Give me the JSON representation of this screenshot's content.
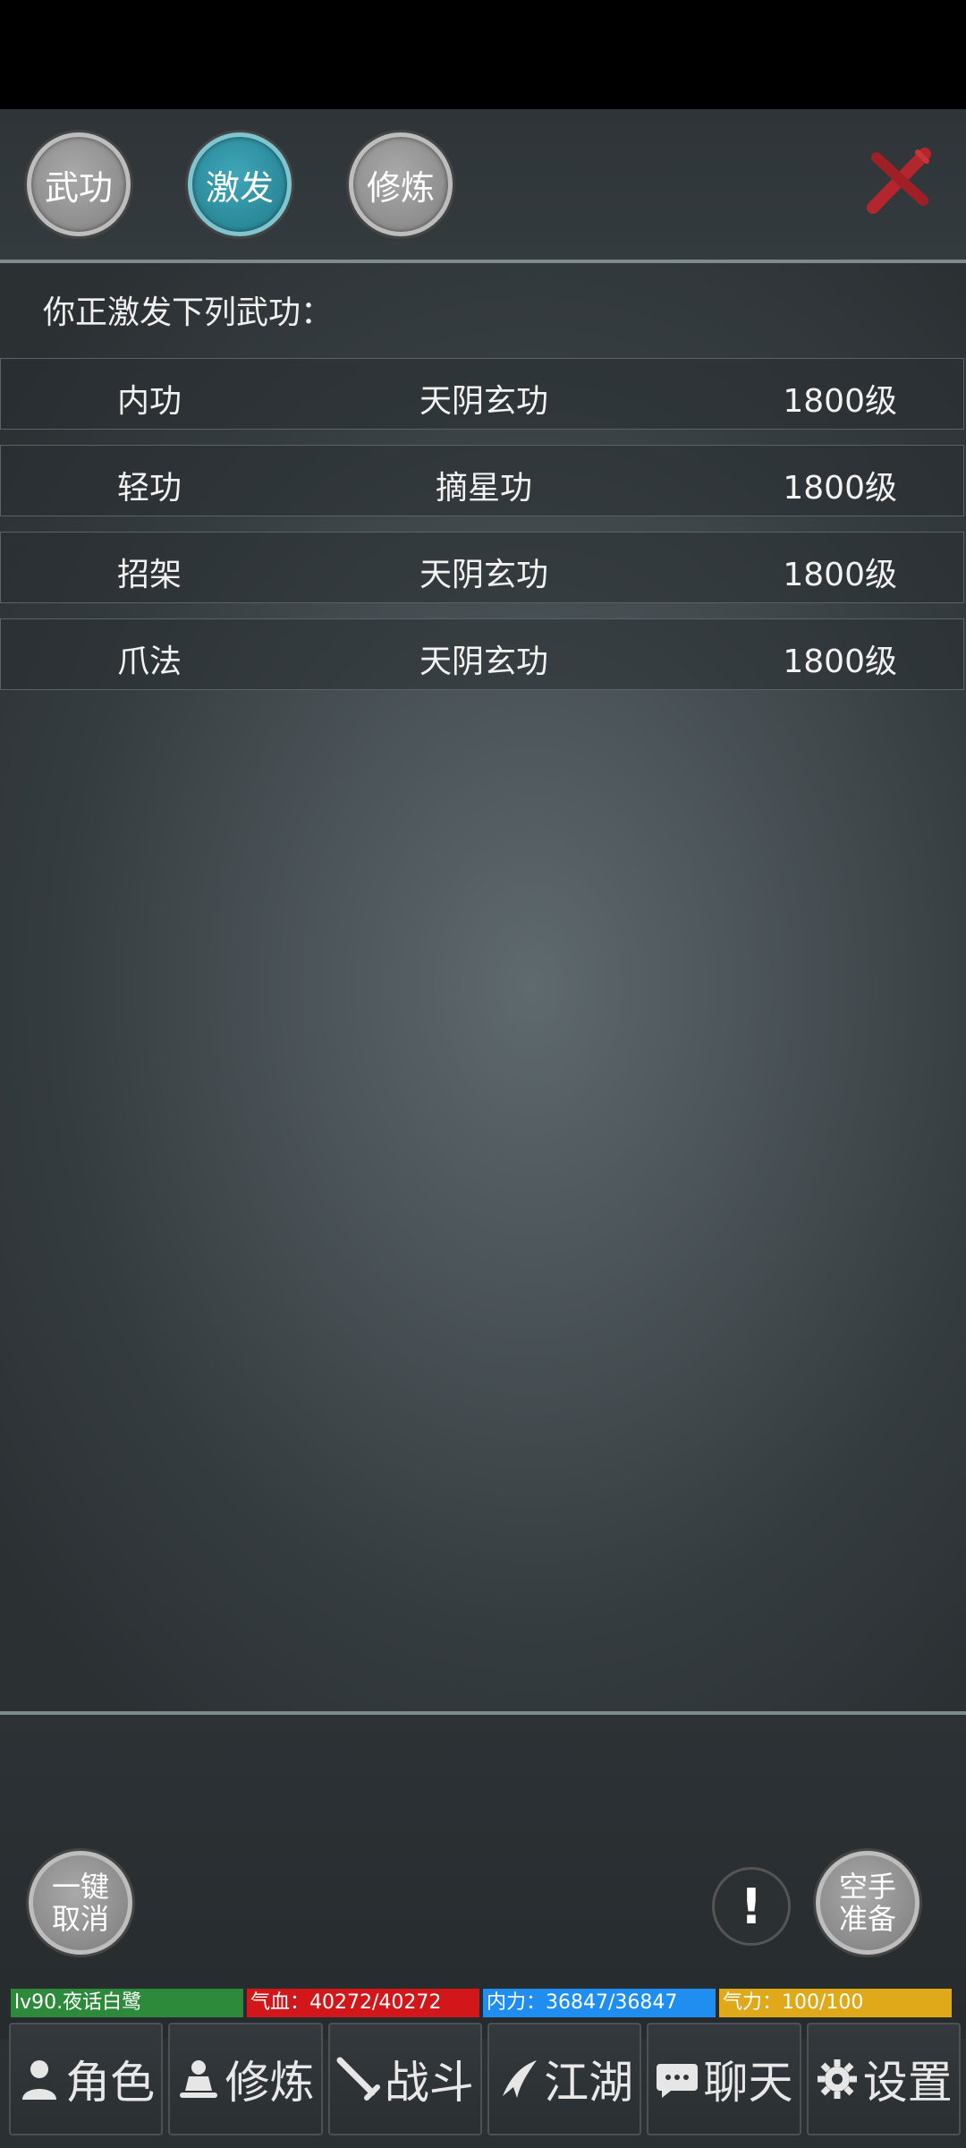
{
  "tabs": [
    {
      "label": "武功",
      "active": false
    },
    {
      "label": "激发",
      "active": true
    },
    {
      "label": "修炼",
      "active": false
    }
  ],
  "heading": "你正激发下列武功：",
  "rows": [
    {
      "type": "内功",
      "skill": "天阴玄功",
      "level": "1800级"
    },
    {
      "type": "轻功",
      "skill": "摘星功",
      "level": "1800级"
    },
    {
      "type": "招架",
      "skill": "天阴玄功",
      "level": "1800级"
    },
    {
      "type": "爪法",
      "skill": "天阴玄功",
      "level": "1800级"
    }
  ],
  "buttons": {
    "cancel_all_line1": "一键",
    "cancel_all_line2": "取消",
    "alert": "!",
    "ready_line1": "空手",
    "ready_line2": "准备"
  },
  "status": {
    "player": "lv90.夜话白鹭",
    "hp": "气血：40272/40272",
    "mp": "内力：36847/36847",
    "qi": "气力：100/100"
  },
  "colors": {
    "player": "#2d8a3a",
    "hp": "#d2161a",
    "mp": "#1f8ef0",
    "qi": "#e0a91a",
    "active_tab": "#2a8898",
    "close": "#b3262d"
  },
  "nav": [
    {
      "label": "角色",
      "icon": "person-icon"
    },
    {
      "label": "修炼",
      "icon": "meditate-icon"
    },
    {
      "label": "战斗",
      "icon": "sword-icon"
    },
    {
      "label": "江湖",
      "icon": "swallow-icon"
    },
    {
      "label": "聊天",
      "icon": "chat-icon"
    },
    {
      "label": "设置",
      "icon": "gear-icon"
    }
  ]
}
